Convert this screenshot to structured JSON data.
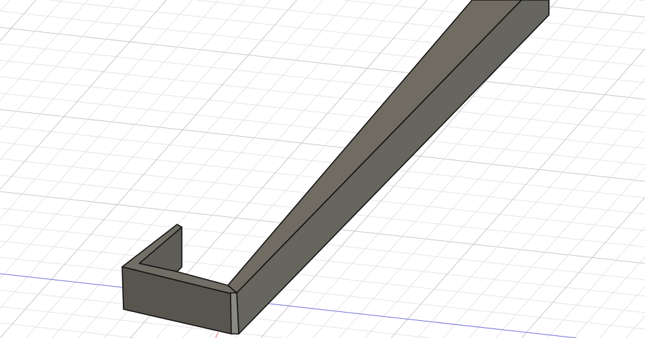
{
  "viewport": {
    "background": "#ffffff",
    "grid_minor_color": "#e4e4e4",
    "grid_major_color": "#c8c8c8",
    "axis_x_color": "#7a7ae6",
    "axis_y_color": "#e07070"
  },
  "model": {
    "top_face_color": "#6f6c63",
    "side_face_color": "#65655f",
    "front_face_color": "#5a5750",
    "edge_color": "#111111"
  }
}
